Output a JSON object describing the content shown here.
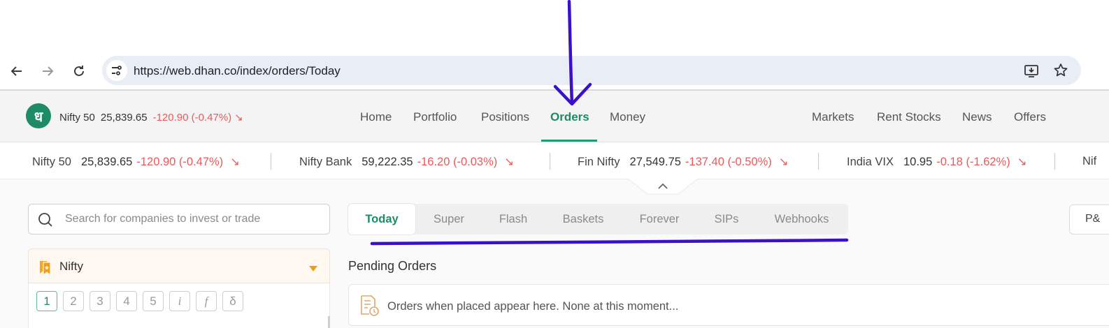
{
  "browser": {
    "url": "https://web.dhan.co/index/orders/Today",
    "back_icon": "arrow-left-icon",
    "forward_icon": "arrow-right-icon",
    "reload_icon": "reload-icon",
    "site_info_icon": "tune-icon",
    "install_icon": "install-app-icon",
    "bookmark_icon": "star-icon"
  },
  "header": {
    "logo_glyph": "ध",
    "ticker": {
      "name": "Nifty 50",
      "value": "25,839.65",
      "change": "-120.90 (-0.47%)",
      "arrow": "↘"
    },
    "nav": [
      "Home",
      "Portfolio",
      "Positions",
      "Orders",
      "Money"
    ],
    "nav_active": "Orders",
    "nav_right": [
      "Markets",
      "Rent Stocks",
      "News",
      "Offers"
    ]
  },
  "ticker_strip": [
    {
      "name": "Nifty 50",
      "value": "25,839.65",
      "change": "-120.90 (-0.47%)",
      "arrow": "↘"
    },
    {
      "name": "Nifty Bank",
      "value": "59,222.35",
      "change": "-16.20 (-0.03%)",
      "arrow": "↘"
    },
    {
      "name": "Fin Nifty",
      "value": "27,549.75",
      "change": "-137.40 (-0.50%)",
      "arrow": "↘"
    },
    {
      "name": "India VIX",
      "value": "10.95",
      "change": "-0.18 (-1.62%)",
      "arrow": "↘"
    },
    {
      "name": "Nif"
    }
  ],
  "search": {
    "placeholder": "Search for companies to invest or trade"
  },
  "order_tabs": [
    "Today",
    "Super",
    "Flash",
    "Baskets",
    "Forever",
    "SIPs",
    "Webhooks"
  ],
  "order_tab_active": "Today",
  "pl_button": "P&",
  "watchlist": {
    "title": "Nifty",
    "pages": [
      "1",
      "2",
      "3",
      "4",
      "5",
      "i",
      "f",
      "δ"
    ],
    "active_page": "1"
  },
  "pending": {
    "title": "Pending Orders",
    "empty_message": "Orders when placed appear here. None at this moment..."
  },
  "colors": {
    "brand_green": "#1e8b64",
    "negative_red": "#e85a5a",
    "annotation_purple": "#3a10c8",
    "watchlist_orange": "#f39c12"
  }
}
